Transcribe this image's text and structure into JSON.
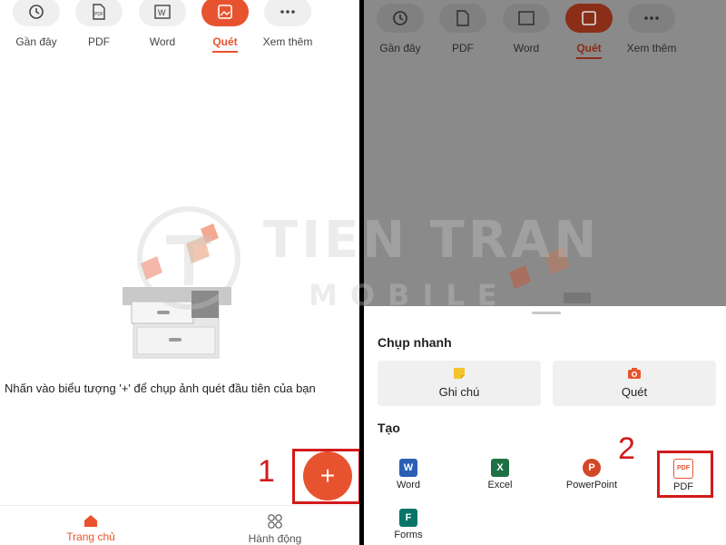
{
  "left_tabs": [
    {
      "label": "Gần đây",
      "icon": "clock-icon"
    },
    {
      "label": "PDF",
      "icon": "pdf-icon"
    },
    {
      "label": "Word",
      "icon": "word-icon"
    },
    {
      "label": "Quét",
      "icon": "scan-image-icon",
      "active": true
    },
    {
      "label": "Xem thêm",
      "icon": "more-icon"
    }
  ],
  "left_message": "Nhấn vào biểu tượng '+' để chụp ảnh quét đầu tiên của bạn",
  "fab_label": "+",
  "step1": "1",
  "step2": "2",
  "bottom_nav": [
    {
      "label": "Trang chủ",
      "icon": "home-icon",
      "active": true
    },
    {
      "label": "Hành động",
      "icon": "actions-icon"
    }
  ],
  "sheet": {
    "quick_title": "Chụp nhanh",
    "quick_buttons": [
      {
        "label": "Ghi chú",
        "icon": "sticky-note-icon"
      },
      {
        "label": "Quét",
        "icon": "camera-icon"
      }
    ],
    "create_title": "Tạo",
    "create_items": [
      {
        "label": "Word",
        "icon": "word-app-icon",
        "glyph": "W"
      },
      {
        "label": "Excel",
        "icon": "excel-app-icon",
        "glyph": "X"
      },
      {
        "label": "PowerPoint",
        "icon": "powerpoint-app-icon",
        "glyph": "P"
      },
      {
        "label": "PDF",
        "icon": "pdf-app-icon",
        "glyph": "PDF"
      },
      {
        "label": "Forms",
        "icon": "forms-app-icon",
        "glyph": "F"
      }
    ]
  },
  "watermark": {
    "line1": "TIEN TRAN",
    "line2": "MOBILE"
  },
  "colors": {
    "accent": "#e8532f",
    "annotation": "#d21b1b",
    "word": "#2b5fb4",
    "excel": "#1e7145",
    "powerpoint": "#d24726",
    "forms": "#077568"
  }
}
